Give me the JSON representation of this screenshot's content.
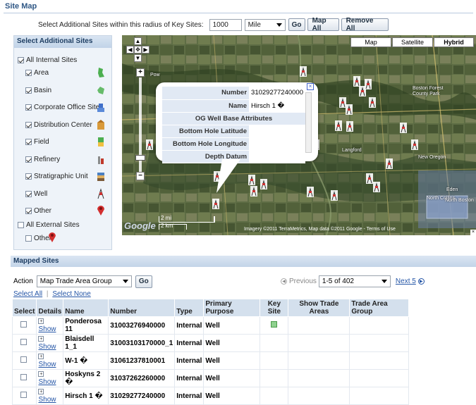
{
  "page": {
    "title": "Site Map"
  },
  "radius": {
    "label": "Select Additional Sites within this radius of Key Sites:",
    "value": "1000",
    "unit": "Mile",
    "go_label": "Go",
    "map_all_label": "Map All",
    "remove_all_label": "Remove All"
  },
  "left_panel": {
    "title": "Select Additional Sites",
    "all_internal_label": "All Internal Sites",
    "items": [
      {
        "label": "Area",
        "checked": true,
        "icon": "area-icon"
      },
      {
        "label": "Basin",
        "checked": true,
        "icon": "basin-icon"
      },
      {
        "label": "Corporate Office Site",
        "checked": true,
        "icon": "office-icon"
      },
      {
        "label": "Distribution Center",
        "checked": true,
        "icon": "distribution-icon"
      },
      {
        "label": "Field",
        "checked": true,
        "icon": "field-icon"
      },
      {
        "label": "Refinery",
        "checked": true,
        "icon": "refinery-icon"
      },
      {
        "label": "Stratigraphic Unit",
        "checked": true,
        "icon": "stratigraphic-icon"
      },
      {
        "label": "Well",
        "checked": true,
        "icon": "well-icon"
      },
      {
        "label": "Other",
        "checked": true,
        "icon": "red-pin-icon"
      }
    ],
    "all_external_label": "All External Sites",
    "external_other_label": "Other"
  },
  "map": {
    "type_buttons": [
      "Map",
      "Satellite",
      "Hybrid"
    ],
    "selected_type": "Hybrid",
    "scale_mi": "2 mi",
    "scale_km": "2 km",
    "attribution": "Imagery ©2011 TerraMetrics, Map data ©2011 Google - Terms of Use",
    "google_logo": "Google",
    "place_labels": [
      "Pow",
      "Boston Forest County Park",
      "Langford",
      "New Oregon",
      "North Collins",
      "Eden",
      "North Boston"
    ],
    "popup": {
      "rows": [
        {
          "key": "Number",
          "value": "31029277240000"
        },
        {
          "key": "Name",
          "value": "Hirsch 1 �"
        },
        {
          "key": "OG Well Base Attributes",
          "value": ""
        },
        {
          "key": "Bottom Hole Latitude",
          "value": ""
        },
        {
          "key": "Bottom Hole Longitude",
          "value": ""
        },
        {
          "key": "Depth Datum",
          "value": ""
        }
      ]
    }
  },
  "mapped": {
    "title": "Mapped Sites",
    "action_label": "Action",
    "action_value": "Map Trade Area Group",
    "go_label": "Go",
    "previous_label": "Previous",
    "range_value": "1-5 of 402",
    "next_label": "Next 5",
    "select_all_label": "Select All",
    "select_none_label": "Select None",
    "columns": [
      "Select",
      "Details",
      "Name",
      "Number",
      "Type",
      "Primary Purpose",
      "Key Site",
      "Show Trade Areas",
      "Trade Area Group"
    ],
    "show_label": "Show",
    "rows": [
      {
        "name": "Ponderosa 11",
        "number": "31003276940000",
        "type": "Internal",
        "purpose": "Well",
        "key_site": true
      },
      {
        "name": "Blaisdell 1_1",
        "number": "31003103170000_1",
        "type": "Internal",
        "purpose": "Well",
        "key_site": false
      },
      {
        "name": "W-1 �",
        "number": "31061237810001",
        "type": "Internal",
        "purpose": "Well",
        "key_site": false
      },
      {
        "name": "Hoskyns 2 �",
        "number": "31037262260000",
        "type": "Internal",
        "purpose": "Well",
        "key_site": false
      },
      {
        "name": "Hirsch 1 �",
        "number": "31029277240000",
        "type": "Internal",
        "purpose": "Well",
        "key_site": false
      }
    ]
  }
}
